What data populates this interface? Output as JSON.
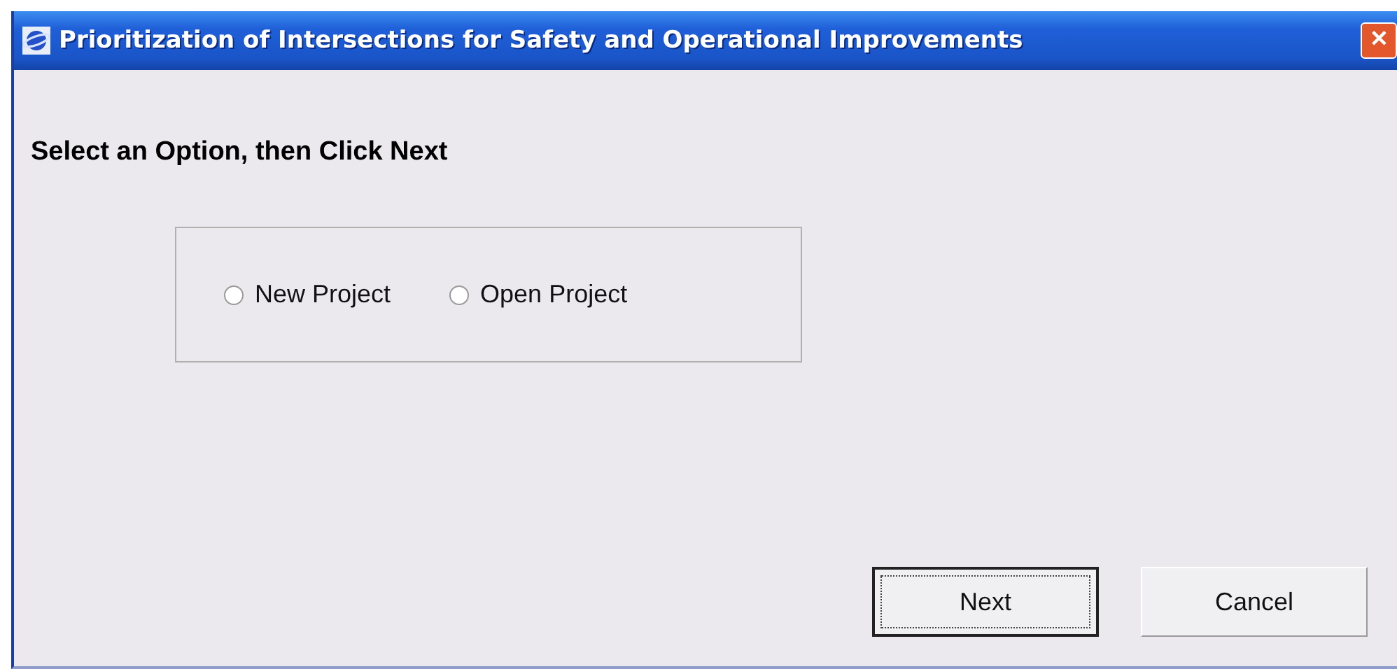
{
  "window": {
    "title": "Prioritization of Intersections for Safety and Operational Improvements",
    "close": "✕"
  },
  "heading": "Select an Option, then Click Next",
  "options": [
    {
      "label": "New Project",
      "selected": false
    },
    {
      "label": "Open Project",
      "selected": false
    }
  ],
  "buttons": [
    {
      "label": "Next",
      "default": true
    },
    {
      "label": "Cancel",
      "default": false
    }
  ]
}
